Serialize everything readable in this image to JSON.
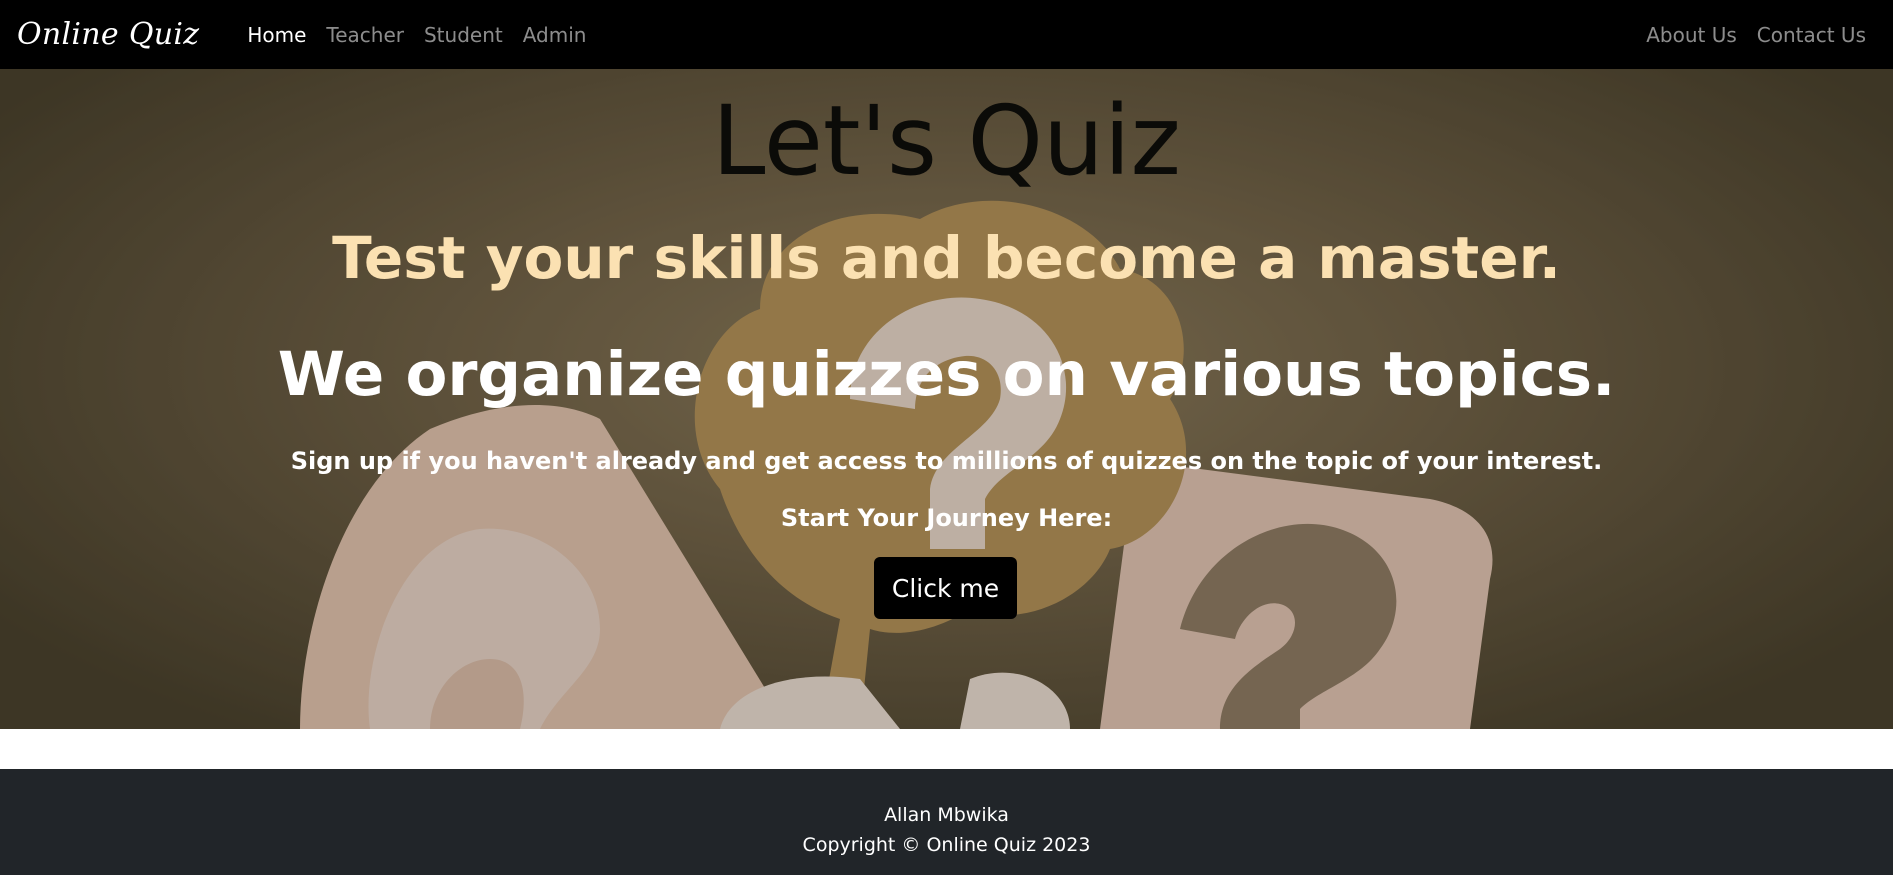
{
  "navbar": {
    "brand": "Online Quiz",
    "left_links": [
      {
        "label": "Home",
        "active": true
      },
      {
        "label": "Teacher",
        "active": false
      },
      {
        "label": "Student",
        "active": false
      },
      {
        "label": "Admin",
        "active": false
      }
    ],
    "right_links": [
      {
        "label": "About Us"
      },
      {
        "label": "Contact Us"
      }
    ]
  },
  "hero": {
    "title": "Let's Quiz",
    "subtitle": "Test your skills and become a master.",
    "headline": "We organize quizzes on various topics.",
    "text": "Sign up if you haven't already and get access to millions of quizzes on the topic of your interest.",
    "cta_prompt": "Start Your Journey Here:",
    "cta_label": "Click me",
    "colors": {
      "title": "#0b0b08",
      "subtitle": "#fbe1b2",
      "headline": "#ffffff",
      "button_bg": "#000000"
    }
  },
  "footer": {
    "author": "Allan Mbwika",
    "copyright": "Copyright © Online Quiz 2023"
  },
  "colors": {
    "navbar_bg": "#000000",
    "footer_bg": "#212529"
  }
}
